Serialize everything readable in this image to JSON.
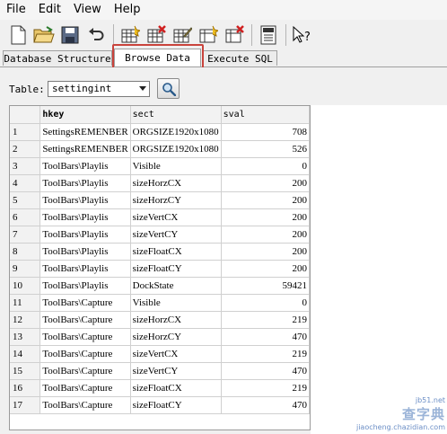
{
  "menu": [
    "File",
    "Edit",
    "View",
    "Help"
  ],
  "tabs": [
    "Database Structure",
    "Browse Data",
    "Execute SQL"
  ],
  "table_selector": {
    "label": "Table:",
    "value": "settingint"
  },
  "grid": {
    "columns": [
      "",
      "hkey",
      "sect",
      "sval"
    ],
    "rows": [
      [
        "1",
        "SettingsREMENBER",
        "ORGSIZE1920x1080",
        "708"
      ],
      [
        "2",
        "SettingsREMENBER",
        "ORGSIZE1920x1080",
        "526"
      ],
      [
        "3",
        "ToolBars\\Playlis",
        "Visible",
        "0"
      ],
      [
        "4",
        "ToolBars\\Playlis",
        "sizeHorzCX",
        "200"
      ],
      [
        "5",
        "ToolBars\\Playlis",
        "sizeHorzCY",
        "200"
      ],
      [
        "6",
        "ToolBars\\Playlis",
        "sizeVertCX",
        "200"
      ],
      [
        "7",
        "ToolBars\\Playlis",
        "sizeVertCY",
        "200"
      ],
      [
        "8",
        "ToolBars\\Playlis",
        "sizeFloatCX",
        "200"
      ],
      [
        "9",
        "ToolBars\\Playlis",
        "sizeFloatCY",
        "200"
      ],
      [
        "10",
        "ToolBars\\Playlis",
        "DockState",
        "59421"
      ],
      [
        "11",
        "ToolBars\\Capture",
        "Visible",
        "0"
      ],
      [
        "12",
        "ToolBars\\Capture",
        "sizeHorzCX",
        "219"
      ],
      [
        "13",
        "ToolBars\\Capture",
        "sizeHorzCY",
        "470"
      ],
      [
        "14",
        "ToolBars\\Capture",
        "sizeVertCX",
        "219"
      ],
      [
        "15",
        "ToolBars\\Capture",
        "sizeVertCY",
        "470"
      ],
      [
        "16",
        "ToolBars\\Capture",
        "sizeFloatCX",
        "219"
      ],
      [
        "17",
        "ToolBars\\Capture",
        "sizeFloatCY",
        "470"
      ]
    ]
  },
  "watermark": {
    "main": "查字典",
    "sub": "jiaocheng.chazidian.com",
    "site": "jb51.net"
  },
  "colors": {
    "highlight": "#c9433c",
    "header_bg": "#f2f2f2"
  },
  "icons": [
    "new-file-icon",
    "open-folder-icon",
    "save-icon",
    "undo-icon",
    "create-table-icon",
    "delete-table-icon",
    "modify-table-icon",
    "create-index-icon",
    "delete-index-icon",
    "log-icon",
    "whats-this-icon",
    "search-icon"
  ]
}
